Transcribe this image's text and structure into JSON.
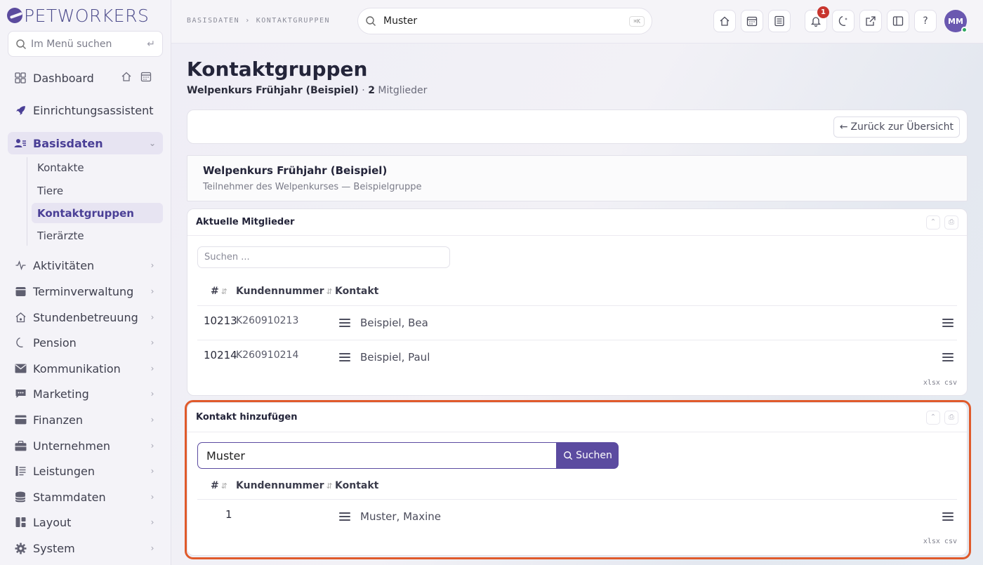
{
  "brand": {
    "logo_text": "PETWORKERS"
  },
  "sidebar": {
    "search_placeholder": "Im Menü suchen",
    "items": [
      {
        "label": "Dashboard",
        "icon": "grid-icon"
      },
      {
        "label": "Einrichtungsassistent",
        "icon": "rocket-icon"
      },
      {
        "label": "Basisdaten",
        "icon": "contacts-icon"
      },
      {
        "label": "Aktivitäten",
        "icon": "pulse-icon"
      },
      {
        "label": "Terminverwaltung",
        "icon": "calendar-icon"
      },
      {
        "label": "Stundenbetreuung",
        "icon": "house-paw-icon"
      },
      {
        "label": "Pension",
        "icon": "moon-icon"
      },
      {
        "label": "Kommunikation",
        "icon": "mail-icon"
      },
      {
        "label": "Marketing",
        "icon": "chat-icon"
      },
      {
        "label": "Finanzen",
        "icon": "card-icon"
      },
      {
        "label": "Unternehmen",
        "icon": "briefcase-icon"
      },
      {
        "label": "Leistungen",
        "icon": "list-icon"
      },
      {
        "label": "Stammdaten",
        "icon": "database-icon"
      },
      {
        "label": "Layout",
        "icon": "layout-icon"
      },
      {
        "label": "System",
        "icon": "gear-icon"
      }
    ],
    "sub_items": [
      {
        "label": "Kontakte"
      },
      {
        "label": "Tiere"
      },
      {
        "label": "Kontaktgruppen"
      },
      {
        "label": "Tierärzte"
      }
    ]
  },
  "topbar": {
    "breadcrumb": [
      "BASISDATEN",
      "›",
      "KONTAKTGRUPPEN"
    ],
    "search_value": "Muster",
    "search_kbd": "⌘K",
    "notification_count": "1",
    "help_label": "?",
    "avatar_initials": "MM"
  },
  "page": {
    "title": "Kontaktgruppen",
    "group_name": "Welpenkurs Frühjahr (Beispiel)",
    "separator": "·",
    "member_count": "2",
    "member_label": "Mitglieder",
    "back_label": "Zurück zur Übersicht"
  },
  "info": {
    "title": "Welpenkurs Frühjahr (Beispiel)",
    "description": "Teilnehmer des Welpenkurses — Beispielgruppe"
  },
  "members": {
    "title": "Aktuelle Mitglieder",
    "search_placeholder": "Suchen ...",
    "columns": [
      "#",
      "Kundennummer",
      "Kontakt"
    ],
    "rows": [
      {
        "id": "10213",
        "kundennummer": "K260910213",
        "kontakt": "Beispiel, Bea"
      },
      {
        "id": "10214",
        "kundennummer": "K260910214",
        "kontakt": "Beispiel, Paul"
      }
    ],
    "export": "xlsx csv"
  },
  "add_contact": {
    "title": "Kontakt hinzufügen",
    "search_value": "Muster",
    "search_button": "Suchen",
    "columns": [
      "#",
      "Kundennummer",
      "Kontakt"
    ],
    "rows": [
      {
        "id": "1",
        "kundennummer": "",
        "kontakt": "Muster, Maxine"
      }
    ],
    "export": "xlsx csv"
  },
  "colors": {
    "accent": "#5b4ba0",
    "focus_ring": "#e05a2b",
    "badge": "#c8352e"
  }
}
